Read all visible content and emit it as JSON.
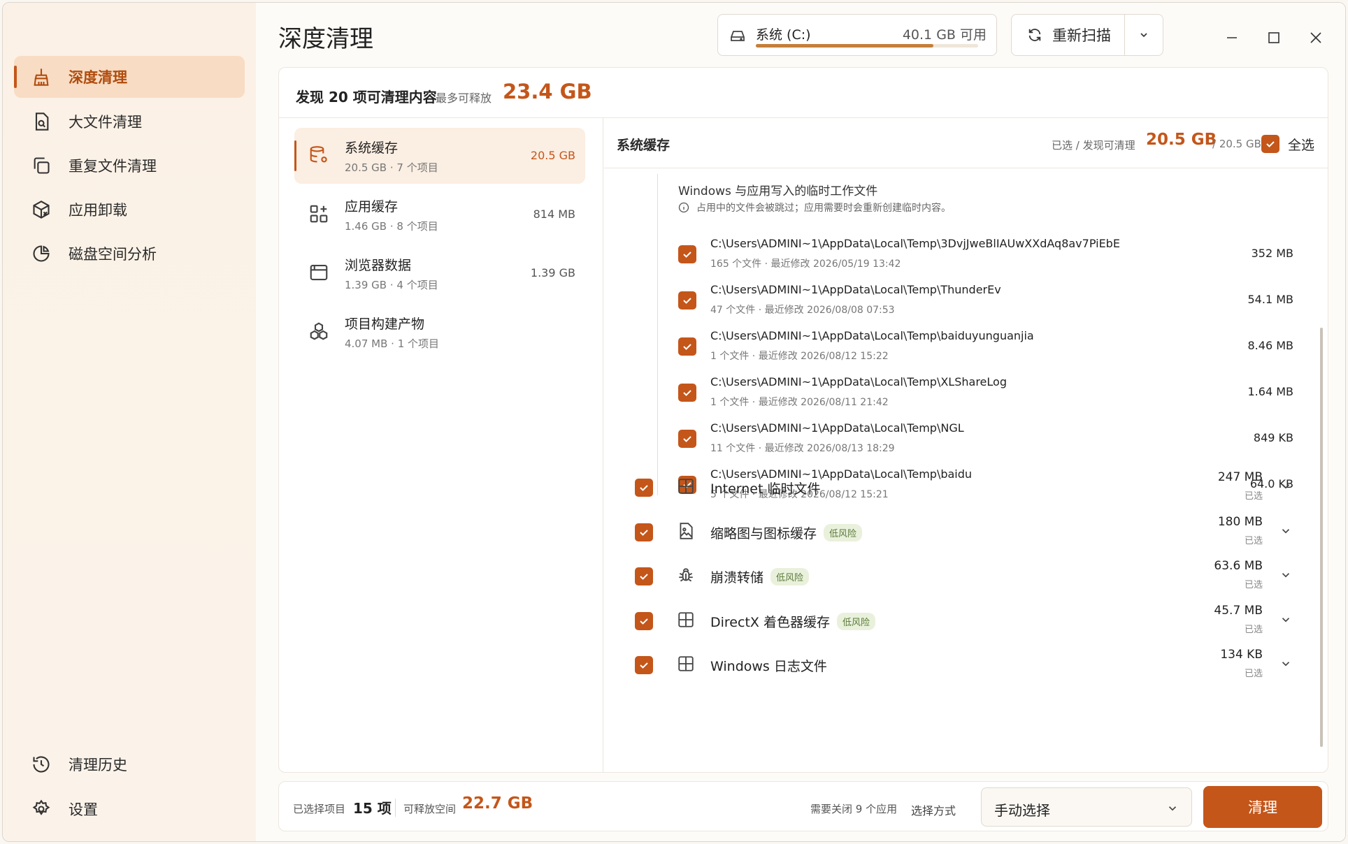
{
  "app": {
    "title": "深度清理"
  },
  "sidebar": {
    "items": [
      {
        "label": "深度清理",
        "icon": "broom-icon",
        "active": true
      },
      {
        "label": "大文件清理",
        "icon": "file-search-icon"
      },
      {
        "label": "重复文件清理",
        "icon": "copy-icon"
      },
      {
        "label": "应用卸载",
        "icon": "package-x-icon"
      },
      {
        "label": "磁盘空间分析",
        "icon": "pie-chart-icon"
      }
    ],
    "bottom": [
      {
        "label": "清理历史",
        "icon": "history-icon"
      },
      {
        "label": "设置",
        "icon": "gear-icon"
      }
    ]
  },
  "drive": {
    "name": "系统 (C:)",
    "free": "40.1 GB 可用",
    "used_fraction": 0.8
  },
  "toolbar": {
    "rescan_label": "重新扫描"
  },
  "summary": {
    "found": "发现 20 项可清理内容",
    "max_label": "最多可释放",
    "max_value": "23.4 GB"
  },
  "categories": [
    {
      "name": "系统缓存",
      "sub": "20.5 GB · 7 个项目",
      "size": "20.5 GB",
      "icon": "database-gear-icon",
      "active": true
    },
    {
      "name": "应用缓存",
      "sub": "1.46 GB · 8 个项目",
      "size": "814 MB",
      "icon": "apps-add-icon"
    },
    {
      "name": "浏览器数据",
      "sub": "1.39 GB · 4 个项目",
      "size": "1.39 GB",
      "icon": "browser-icon"
    },
    {
      "name": "项目构建产物",
      "sub": "4.07 MB · 1 个项目",
      "size": "",
      "icon": "boxes-icon"
    }
  ],
  "detail": {
    "title": "系统缓存",
    "selected_label": "已选 / 发现可清理",
    "selected_value": "20.5 GB",
    "total": "/ 20.5 GB",
    "select_all": "全选",
    "sub_desc": "Windows 与应用写入的临时工作文件",
    "sub_note": "占用中的文件会被跳过；应用需要时会重新创建临时内容。",
    "paths": [
      {
        "path": "C:\\Users\\ADMINI~1\\AppData\\Local\\Temp\\3DvjJweBlIAUwXXdAq8av7PiEbE",
        "meta": "165 个文件 · 最近修改 2026/05/19 13:42",
        "size": "352 MB"
      },
      {
        "path": "C:\\Users\\ADMINI~1\\AppData\\Local\\Temp\\ThunderEv",
        "meta": "47 个文件 · 最近修改 2026/08/08 07:53",
        "size": "54.1 MB"
      },
      {
        "path": "C:\\Users\\ADMINI~1\\AppData\\Local\\Temp\\baiduyunguanjia",
        "meta": "1 个文件 · 最近修改 2026/08/12 15:22",
        "size": "8.46 MB"
      },
      {
        "path": "C:\\Users\\ADMINI~1\\AppData\\Local\\Temp\\XLShareLog",
        "meta": "1 个文件 · 最近修改 2026/08/11 21:42",
        "size": "1.64 MB"
      },
      {
        "path": "C:\\Users\\ADMINI~1\\AppData\\Local\\Temp\\NGL",
        "meta": "11 个文件 · 最近修改 2026/08/13 18:29",
        "size": "849 KB"
      },
      {
        "path": "C:\\Users\\ADMINI~1\\AppData\\Local\\Temp\\baidu",
        "meta": "5 个文件 · 最近修改 2026/08/12 15:21",
        "size": "64.0 KB"
      }
    ],
    "groups": [
      {
        "name": "Internet 临时文件",
        "size": "247 MB",
        "sel": "已选",
        "risk": "",
        "icon": "windows-icon"
      },
      {
        "name": "缩略图与图标缓存",
        "size": "180 MB",
        "sel": "已选",
        "risk": "低风险",
        "icon": "image-icon"
      },
      {
        "name": "崩溃转储",
        "size": "63.6 MB",
        "sel": "已选",
        "risk": "低风险",
        "icon": "bug-icon"
      },
      {
        "name": "DirectX 着色器缓存",
        "size": "45.7 MB",
        "sel": "已选",
        "risk": "低风险",
        "icon": "windows-icon"
      },
      {
        "name": "Windows 日志文件",
        "size": "134 KB",
        "sel": "已选",
        "risk": "",
        "icon": "windows-icon"
      }
    ]
  },
  "footer": {
    "selected_label": "已选择项目",
    "selected_value": "15 项",
    "free_label": "可释放空间",
    "free_value": "22.7 GB",
    "close_apps": "需要关闭 9 个应用",
    "mode_label": "选择方式",
    "mode_value": "手动选择",
    "clean_button": "清理"
  },
  "colors": {
    "accent": "#c4561a",
    "sidebar_bg": "#fbf1e6",
    "active_bg": "#f8dcc3"
  }
}
